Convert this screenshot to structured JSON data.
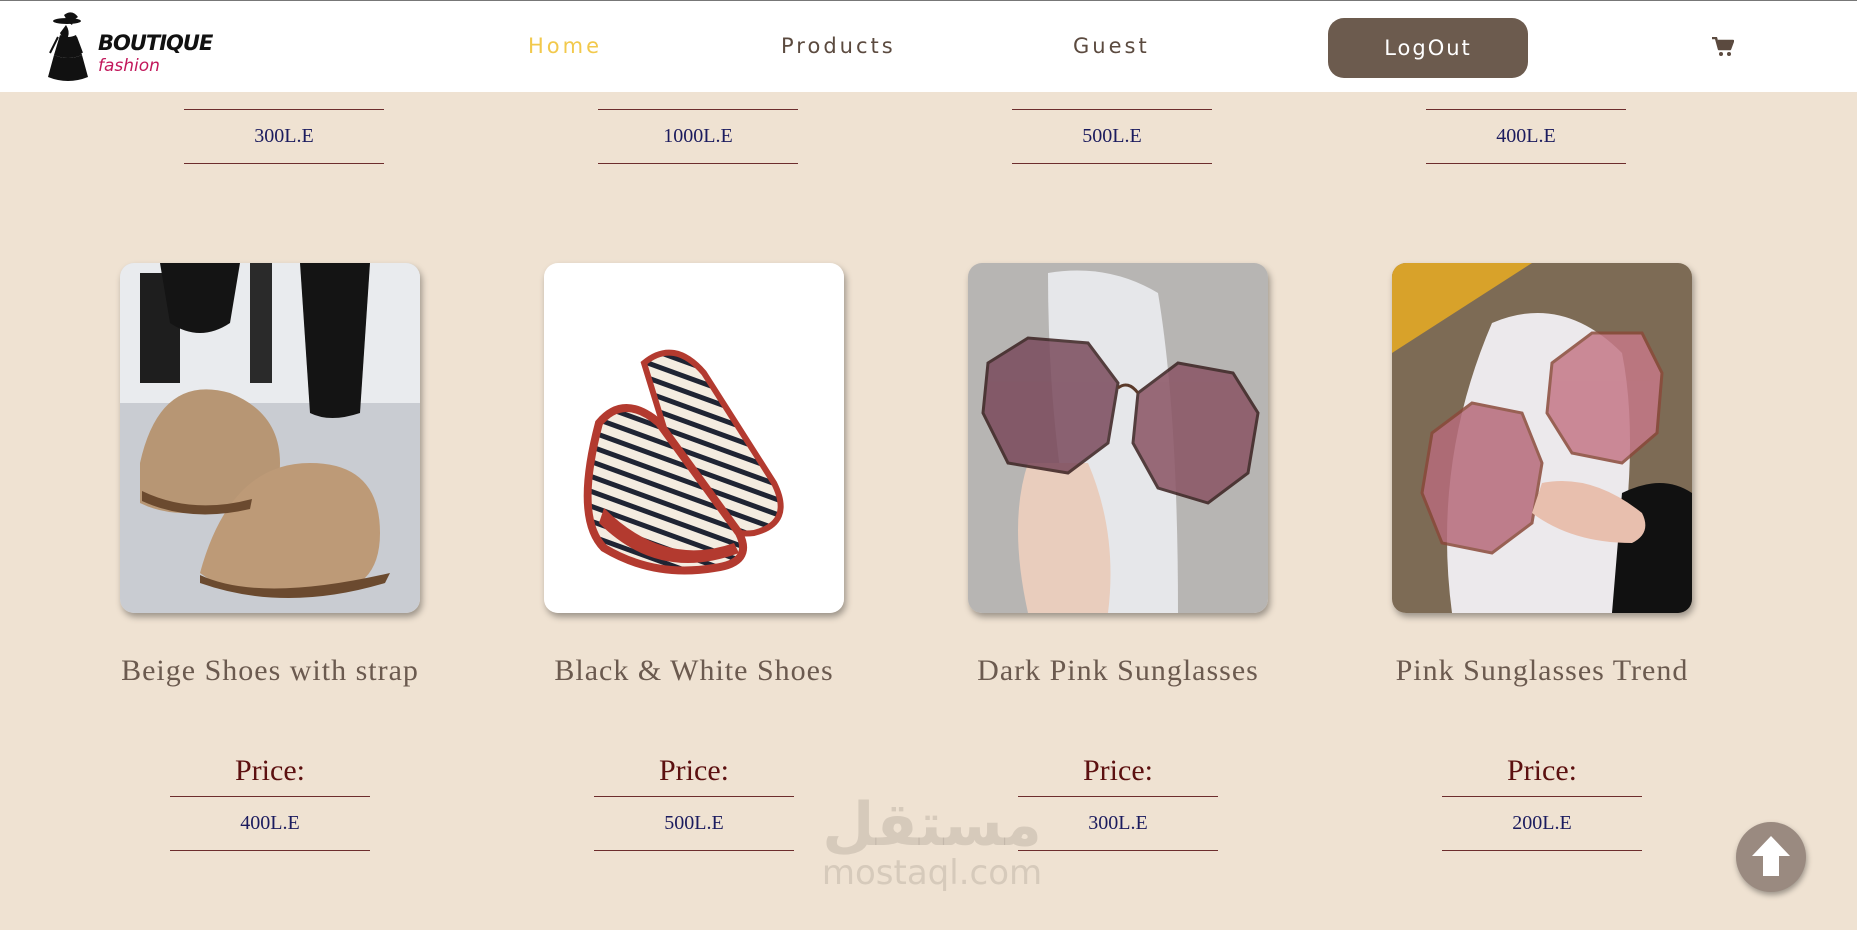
{
  "nav": {
    "logo_line1": "BOUTIQUE",
    "logo_line2": "fashion",
    "links": [
      "Home",
      "Products",
      "Guest"
    ],
    "active": "Home",
    "logout_label": "LogOut",
    "cart_icon": "cart-icon"
  },
  "top_row_prices": [
    "300L.E",
    "1000L.E",
    "500L.E",
    "400L.E"
  ],
  "products": [
    {
      "name": "Beige Shoes with strap",
      "price_label": "Price:",
      "price": "400L.E",
      "image": "beige-shoes-image"
    },
    {
      "name": "Black & White Shoes",
      "price_label": "Price:",
      "price": "500L.E",
      "image": "striped-espadrilles-image"
    },
    {
      "name": "Dark Pink Sunglasses",
      "price_label": "Price:",
      "price": "300L.E",
      "image": "dark-pink-sunglasses-image"
    },
    {
      "name": "Pink Sunglasses Trend",
      "price_label": "Price:",
      "price": "200L.E",
      "image": "pink-sunglasses-image"
    }
  ],
  "watermark": {
    "arabic": "مستقل",
    "latin": "mostaql.com"
  },
  "scroll_top_icon": "arrow-up-icon",
  "colors": {
    "background": "#efe2d2",
    "accent": "#f2c94c",
    "button": "#6c5b4e",
    "price_text": "#1b1b5e"
  }
}
